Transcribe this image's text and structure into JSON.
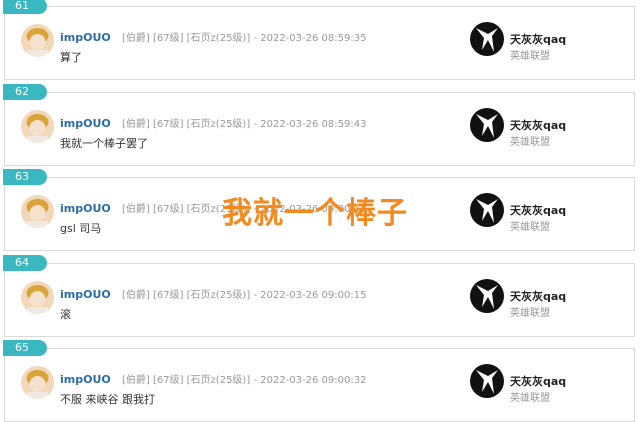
{
  "posts": [
    {
      "floor": "61",
      "username": "impOUO",
      "title": "[伯爵]",
      "level": "[67级]",
      "rank": "[石页z(25级)]",
      "separator": "-",
      "timestamp": "2022-03-26 08:59:35",
      "content": "算了",
      "right_name": "天灰灰qaq",
      "right_sub": "英雄联盟"
    },
    {
      "floor": "62",
      "username": "impOUO",
      "title": "[伯爵]",
      "level": "[67级]",
      "rank": "[石页z(25级)]",
      "separator": "-",
      "timestamp": "2022-03-26 08:59:43",
      "content": "我就一个棒子罢了",
      "right_name": "天灰灰qaq",
      "right_sub": "英雄联盟"
    },
    {
      "floor": "63",
      "username": "impOUO",
      "title": "[伯爵]",
      "level": "[67级]",
      "rank": "[石页z(25级)]",
      "separator": "-",
      "timestamp": "2022-03-26 09:00:12",
      "content": "gsl 司马",
      "right_name": "天灰灰qaq",
      "right_sub": "英雄联盟"
    },
    {
      "floor": "64",
      "username": "impOUO",
      "title": "[伯爵]",
      "level": "[67级]",
      "rank": "[石页z(25级)]",
      "separator": "-",
      "timestamp": "2022-03-26 09:00:15",
      "content": "滚",
      "right_name": "天灰灰qaq",
      "right_sub": "英雄联盟"
    },
    {
      "floor": "65",
      "username": "impOUO",
      "title": "[伯爵]",
      "level": "[67级]",
      "rank": "[石页z(25级)]",
      "separator": "-",
      "timestamp": "2022-03-26 09:00:32",
      "content": "不服 来峡谷 跟我打",
      "right_name": "天灰灰qaq",
      "right_sub": "英雄联盟"
    }
  ],
  "overlay_caption": "我就一个棒子",
  "colors": {
    "floor_tag": "#39b8c2",
    "username": "#2b6ca8",
    "caption": "#f28a1f"
  },
  "icons": {
    "left_avatar": "user-avatar-icon",
    "right_avatar": "forum-avatar-icon"
  }
}
